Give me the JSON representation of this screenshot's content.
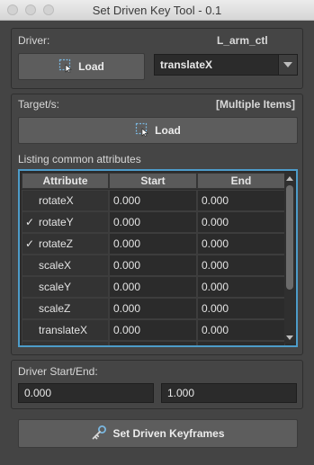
{
  "window": {
    "title": "Set Driven Key Tool - 0.1"
  },
  "driver": {
    "label": "Driver:",
    "name": "L_arm_ctl",
    "load_label": "Load",
    "attribute_selected": "translateX"
  },
  "target": {
    "label": "Target/s:",
    "selection": "[Multiple Items]",
    "load_label": "Load"
  },
  "common": {
    "label": "Listing common attributes",
    "columns": [
      "Attribute",
      "Start",
      "End"
    ],
    "rows": [
      {
        "check": "",
        "attribute": "rotateX",
        "start": "0.000",
        "end": "0.000"
      },
      {
        "check": "✓",
        "attribute": "rotateY",
        "start": "0.000",
        "end": "0.000"
      },
      {
        "check": "✓",
        "attribute": "rotateZ",
        "start": "0.000",
        "end": "0.000"
      },
      {
        "check": "",
        "attribute": "scaleX",
        "start": "0.000",
        "end": "0.000"
      },
      {
        "check": "",
        "attribute": "scaleY",
        "start": "0.000",
        "end": "0.000"
      },
      {
        "check": "",
        "attribute": "scaleZ",
        "start": "0.000",
        "end": "0.000"
      },
      {
        "check": "",
        "attribute": "translateX",
        "start": "0.000",
        "end": "0.000"
      }
    ]
  },
  "driver_range": {
    "label": "Driver Start/End:",
    "start": "0.000",
    "end": "1.000"
  },
  "action": {
    "label": "Set Driven Keyframes"
  },
  "colors": {
    "accent": "#4d9cc9",
    "background": "#444444"
  }
}
